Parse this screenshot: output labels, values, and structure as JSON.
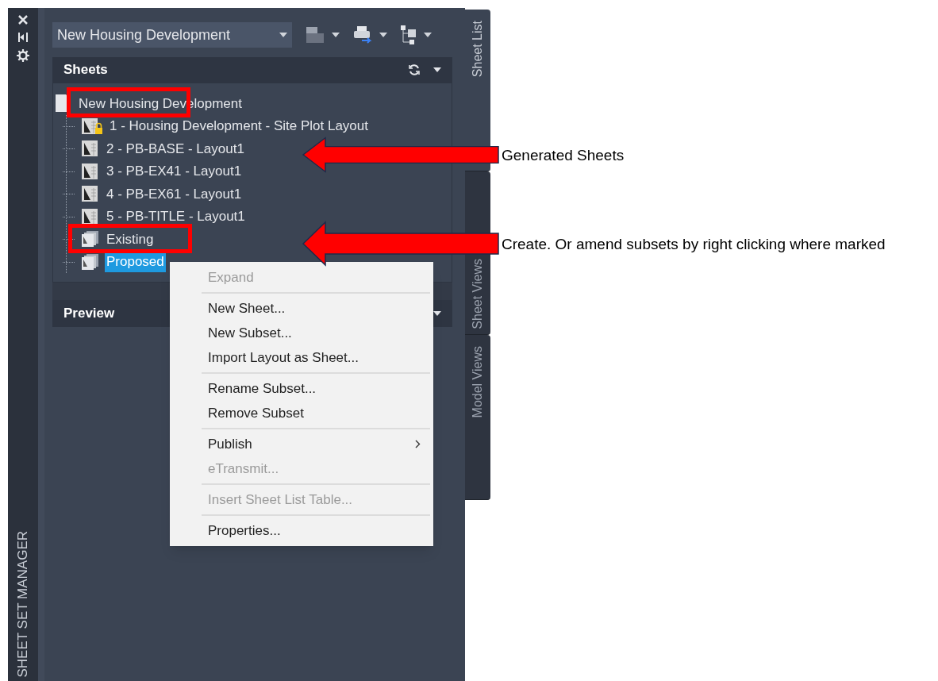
{
  "side_strip": {
    "title": "SHEET SET MANAGER"
  },
  "sheet_set_dropdown": {
    "value": "New Housing Development"
  },
  "sheets_panel": {
    "title": "Sheets",
    "tree": {
      "label": "New Housing Development",
      "kind": "set",
      "selected": false,
      "children": [
        {
          "label": "1 - Housing Development - Site Plot Layout",
          "kind": "sheet",
          "locked": true,
          "selected": false
        },
        {
          "label": "2 - PB-BASE - Layout1",
          "kind": "sheet",
          "locked": false,
          "selected": false
        },
        {
          "label": "3 - PB-EX41 - Layout1",
          "kind": "sheet",
          "locked": false,
          "selected": false
        },
        {
          "label": "4 - PB-EX61 - Layout1",
          "kind": "sheet",
          "locked": false,
          "selected": false
        },
        {
          "label": "5 - PB-TITLE - Layout1",
          "kind": "sheet",
          "locked": false,
          "selected": false
        },
        {
          "label": "Existing",
          "kind": "subset",
          "selected": false
        },
        {
          "label": "Proposed",
          "kind": "subset",
          "selected": true
        }
      ]
    }
  },
  "preview_panel": {
    "title": "Preview"
  },
  "tabs": [
    {
      "label": "Sheet List",
      "selected": true
    },
    {
      "label": "Sheet Views",
      "selected": false
    },
    {
      "label": "Model Views",
      "selected": false
    }
  ],
  "context_menu": [
    {
      "label": "Expand",
      "disabled": true,
      "submenu": false
    },
    {
      "kind": "separator"
    },
    {
      "label": "New Sheet...",
      "disabled": false,
      "submenu": false
    },
    {
      "label": "New Subset...",
      "disabled": false,
      "submenu": false
    },
    {
      "label": "Import Layout as Sheet...",
      "disabled": false,
      "submenu": false
    },
    {
      "kind": "separator"
    },
    {
      "label": "Rename Subset...",
      "disabled": false,
      "submenu": false
    },
    {
      "label": "Remove Subset",
      "disabled": false,
      "submenu": false
    },
    {
      "kind": "separator"
    },
    {
      "label": "Publish",
      "disabled": false,
      "submenu": true
    },
    {
      "label": "eTransmit...",
      "disabled": true,
      "submenu": false
    },
    {
      "kind": "separator"
    },
    {
      "label": "Insert Sheet List Table...",
      "disabled": true,
      "submenu": false
    },
    {
      "kind": "separator"
    },
    {
      "label": "Properties...",
      "disabled": false,
      "submenu": false
    }
  ],
  "annotations": [
    {
      "text": "Generated Sheets"
    },
    {
      "text": "Create. Or amend subsets by right clicking where marked"
    }
  ]
}
